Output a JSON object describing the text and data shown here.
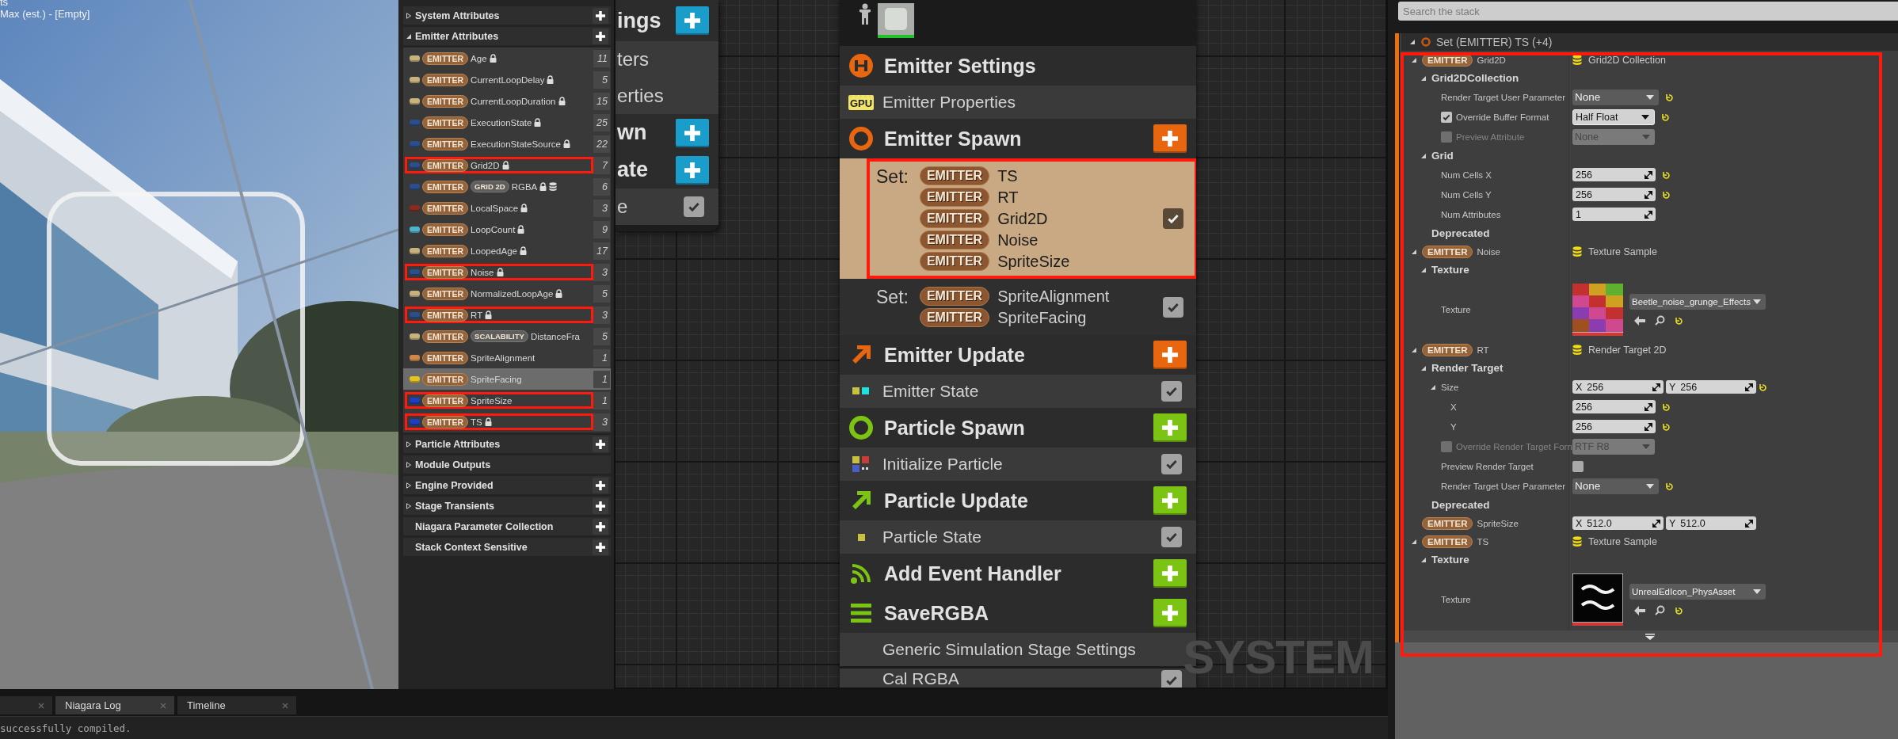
{
  "viewport": {
    "lines": [
      "ts",
      "Max (est.) - [Empty]"
    ]
  },
  "parameters": {
    "sections": [
      {
        "kind": "group",
        "label": "System Attributes",
        "expanded": false,
        "add": true
      },
      {
        "kind": "group",
        "label": "Emitter Attributes",
        "expanded": true,
        "add": true,
        "items": [
          {
            "scope": "EMITTER",
            "name": "Age",
            "color": "#c9b27c",
            "locked": true,
            "stored": false,
            "count": "11",
            "selected": false,
            "highlighted": false
          },
          {
            "scope": "EMITTER",
            "name": "CurrentLoopDelay",
            "color": "#c9b27c",
            "locked": true,
            "stored": false,
            "count": "5",
            "selected": false,
            "highlighted": false
          },
          {
            "scope": "EMITTER",
            "name": "CurrentLoopDuration",
            "color": "#c9b27c",
            "locked": true,
            "stored": false,
            "count": "15",
            "selected": false,
            "highlighted": false
          },
          {
            "scope": "EMITTER",
            "name": "ExecutionState",
            "color": "#2b4f8c",
            "locked": true,
            "stored": false,
            "count": "25",
            "selected": false,
            "highlighted": false
          },
          {
            "scope": "EMITTER",
            "name": "ExecutionStateSource",
            "color": "#2b4f8c",
            "locked": true,
            "stored": false,
            "count": "22",
            "selected": false,
            "highlighted": false
          },
          {
            "scope": "EMITTER",
            "name": "Grid2D",
            "color": "#2b4f8c",
            "locked": true,
            "stored": false,
            "count": "7",
            "selected": false,
            "highlighted": true
          },
          {
            "scope": "EMITTER",
            "tag": "GRID 2D",
            "name": "RGBA",
            "color": "#2b4f8c",
            "locked": true,
            "stored": true,
            "count": "6",
            "selected": false,
            "highlighted": false
          },
          {
            "scope": "EMITTER",
            "name": "LocalSpace",
            "color": "#8a2b20",
            "locked": true,
            "stored": false,
            "count": "3",
            "selected": false,
            "highlighted": false
          },
          {
            "scope": "EMITTER",
            "name": "LoopCount",
            "color": "#4fb3cc",
            "locked": true,
            "stored": false,
            "count": "9",
            "selected": false,
            "highlighted": false
          },
          {
            "scope": "EMITTER",
            "name": "LoopedAge",
            "color": "#c9b27c",
            "locked": true,
            "stored": false,
            "count": "17",
            "selected": false,
            "highlighted": false
          },
          {
            "scope": "EMITTER",
            "name": "Noise",
            "color": "#2b4f8c",
            "locked": true,
            "stored": false,
            "count": "3",
            "selected": false,
            "highlighted": true
          },
          {
            "scope": "EMITTER",
            "name": "NormalizedLoopAge",
            "color": "#c9b27c",
            "locked": true,
            "stored": false,
            "count": "5",
            "selected": false,
            "highlighted": false
          },
          {
            "scope": "EMITTER",
            "name": "RT",
            "color": "#2b4f8c",
            "locked": true,
            "stored": false,
            "count": "3",
            "selected": false,
            "highlighted": true
          },
          {
            "scope": "EMITTER",
            "tag": "SCALABILITY",
            "name": "DistanceFra",
            "color": "#c9b27c",
            "locked": false,
            "stored": false,
            "count": "5",
            "selected": false,
            "highlighted": false
          },
          {
            "scope": "EMITTER",
            "name": "SpriteAlignment",
            "color": "#d0884a",
            "locked": false,
            "stored": false,
            "count": "1",
            "selected": false,
            "highlighted": false
          },
          {
            "scope": "EMITTER",
            "name": "SpriteFacing",
            "color": "#e6c21c",
            "locked": false,
            "stored": false,
            "count": "1",
            "selected": true,
            "highlighted": false
          },
          {
            "scope": "EMITTER",
            "name": "SpriteSize",
            "color": "#1c3fc4",
            "locked": false,
            "stored": false,
            "count": "1",
            "selected": false,
            "highlighted": true
          },
          {
            "scope": "EMITTER",
            "name": "TS",
            "color": "#1c3fc4",
            "locked": true,
            "stored": false,
            "count": "3",
            "selected": false,
            "highlighted": true
          }
        ]
      },
      {
        "kind": "group",
        "label": "Particle Attributes",
        "expanded": false,
        "add": true
      },
      {
        "kind": "group",
        "label": "Module Outputs",
        "expanded": false,
        "add": false
      },
      {
        "kind": "group",
        "label": "Engine Provided",
        "expanded": false,
        "add": true
      },
      {
        "kind": "group",
        "label": "Stage Transients",
        "expanded": false,
        "add": true
      },
      {
        "kind": "plain",
        "label": "Niagara Parameter Collection",
        "add": true
      },
      {
        "kind": "plain",
        "label": "Stack Context Sensitive",
        "add": true
      }
    ]
  },
  "graph": {
    "label": "SYSTEM",
    "system_node": {
      "rows": [
        {
          "kind": "stage",
          "label": "ings",
          "color": "#1b9dcc"
        },
        {
          "kind": "module",
          "label": "ters"
        },
        {
          "kind": "module",
          "label": "erties"
        },
        {
          "kind": "stage",
          "label": "wn",
          "color": "#1b9dcc"
        },
        {
          "kind": "stage",
          "label": "ate",
          "color": "#1b9dcc"
        },
        {
          "kind": "module",
          "label": "e",
          "enabled": true
        }
      ]
    },
    "emitter_node": {
      "rows": [
        {
          "kind": "stage",
          "label": "Emitter Settings",
          "color": "#e8660f",
          "add": false
        },
        {
          "kind": "module",
          "label": "Emitter Properties",
          "badge": "GPU"
        },
        {
          "kind": "stage",
          "label": "Emitter Spawn",
          "color": "#e8660f",
          "add": true
        },
        {
          "kind": "set",
          "label": "Set:",
          "selected": true,
          "highlighted": true,
          "enabled": true,
          "params": [
            {
              "scope": "EMITTER",
              "name": "TS"
            },
            {
              "scope": "EMITTER",
              "name": "RT"
            },
            {
              "scope": "EMITTER",
              "name": "Grid2D"
            },
            {
              "scope": "EMITTER",
              "name": "Noise"
            },
            {
              "scope": "EMITTER",
              "name": "SpriteSize"
            }
          ]
        },
        {
          "kind": "set",
          "label": "Set:",
          "selected": false,
          "highlighted": false,
          "enabled": true,
          "params": [
            {
              "scope": "EMITTER",
              "name": "SpriteAlignment"
            },
            {
              "scope": "EMITTER",
              "name": "SpriteFacing"
            }
          ]
        },
        {
          "kind": "stage",
          "label": "Emitter Update",
          "color": "#e8660f",
          "add": true
        },
        {
          "kind": "module",
          "label": "Emitter State",
          "enabled": true
        },
        {
          "kind": "stage",
          "label": "Particle Spawn",
          "color": "#7cc414",
          "add": true
        },
        {
          "kind": "module",
          "label": "Initialize Particle",
          "enabled": true
        },
        {
          "kind": "stage",
          "label": "Particle Update",
          "color": "#7cc414",
          "add": true
        },
        {
          "kind": "module",
          "label": "Particle State",
          "enabled": true
        },
        {
          "kind": "stage",
          "label": "Add Event Handler",
          "color": "#7cc414",
          "add": true
        },
        {
          "kind": "stage",
          "label": "SaveRGBA",
          "color": "#7cc414",
          "add": true
        },
        {
          "kind": "module",
          "label": "Generic Simulation Stage Settings"
        },
        {
          "kind": "module",
          "label": "Cal RGBA",
          "enabled": true
        }
      ]
    }
  },
  "stack": {
    "search": {
      "placeholder": "Search the stack"
    },
    "header": {
      "title": "Set (EMITTER) TS (+4)",
      "expanded": true
    },
    "highlighted": true,
    "entries": [
      {
        "kind": "param",
        "scope": "EMITTER",
        "name": "Grid2D",
        "expanded": true,
        "value": {
          "kind": "object",
          "text": "Grid2D Collection"
        },
        "children": [
          {
            "kind": "category",
            "label": "Grid2DCollection",
            "expanded": true,
            "children": [
              {
                "kind": "property",
                "label": "Render Target User Parameter",
                "reset": true,
                "value": {
                  "kind": "combo",
                  "text": "None",
                  "disabled": false
                }
              },
              {
                "kind": "property",
                "label": "Override Buffer Format",
                "checkbox": {
                  "checked": true,
                  "disabled": false
                },
                "reset": true,
                "value": {
                  "kind": "dropdown",
                  "text": "Half Float",
                  "disabled": false
                }
              },
              {
                "kind": "property",
                "label": "Preview Attribute",
                "checkbox": {
                  "checked": false,
                  "disabled": true
                },
                "reset": false,
                "value": {
                  "kind": "dropdown",
                  "text": "None",
                  "disabled": true
                }
              }
            ]
          },
          {
            "kind": "category",
            "label": "Grid",
            "expanded": true,
            "children": [
              {
                "kind": "property",
                "label": "Num Cells X",
                "reset": true,
                "value": {
                  "kind": "number",
                  "text": "256"
                }
              },
              {
                "kind": "property",
                "label": "Num Cells Y",
                "reset": true,
                "value": {
                  "kind": "number",
                  "text": "256"
                }
              },
              {
                "kind": "property",
                "label": "Num Attributes",
                "reset": false,
                "value": {
                  "kind": "number",
                  "text": "1"
                }
              }
            ]
          },
          {
            "kind": "category",
            "label": "Deprecated"
          }
        ]
      },
      {
        "kind": "param",
        "scope": "EMITTER",
        "name": "Noise",
        "expanded": true,
        "value": {
          "kind": "object",
          "text": "Texture Sample"
        },
        "children": [
          {
            "kind": "category",
            "label": "Texture",
            "expanded": true,
            "children": [
              {
                "kind": "property",
                "label": "Texture",
                "reset": true,
                "value": {
                  "kind": "texture",
                  "asset": "Beetle_noise_grunge_Effects",
                  "thumbnail": {
                    "kind": "noise"
                  }
                }
              }
            ]
          }
        ]
      },
      {
        "kind": "param",
        "scope": "EMITTER",
        "name": "RT",
        "expanded": true,
        "value": {
          "kind": "object",
          "text": "Render Target 2D"
        },
        "children": [
          {
            "kind": "category",
            "label": "Render Target",
            "expanded": true,
            "children": [
              {
                "kind": "property",
                "label": "Size",
                "expanded": true,
                "reset": true,
                "value": {
                  "kind": "vector",
                  "fields": [
                    {
                      "axis": "X",
                      "text": "256"
                    },
                    {
                      "axis": "Y",
                      "text": "256"
                    }
                  ]
                },
                "children": [
                  {
                    "kind": "property",
                    "label": "X",
                    "reset": true,
                    "value": {
                      "kind": "number",
                      "text": "256"
                    }
                  },
                  {
                    "kind": "property",
                    "label": "Y",
                    "reset": true,
                    "value": {
                      "kind": "number",
                      "text": "256"
                    }
                  }
                ]
              },
              {
                "kind": "property",
                "label": "Override Render Target Forn",
                "checkbox": {
                  "checked": false,
                  "disabled": true
                },
                "reset": false,
                "value": {
                  "kind": "dropdown",
                  "text": "RTF R8",
                  "disabled": true
                }
              },
              {
                "kind": "property",
                "label": "Preview Render Target",
                "reset": false,
                "value": {
                  "kind": "checkbox",
                  "checked": false
                }
              },
              {
                "kind": "property",
                "label": "Render Target User Parameter",
                "reset": true,
                "value": {
                  "kind": "combo",
                  "text": "None",
                  "disabled": false
                }
              }
            ]
          },
          {
            "kind": "category",
            "label": "Deprecated"
          }
        ]
      },
      {
        "kind": "param",
        "scope": "EMITTER",
        "name": "SpriteSize",
        "value": {
          "kind": "vector",
          "fields": [
            {
              "axis": "X",
              "text": "512.0"
            },
            {
              "axis": "Y",
              "text": "512.0"
            }
          ]
        }
      },
      {
        "kind": "param",
        "scope": "EMITTER",
        "name": "TS",
        "expanded": true,
        "value": {
          "kind": "object",
          "text": "Texture Sample"
        },
        "children": [
          {
            "kind": "category",
            "label": "Texture",
            "expanded": true,
            "children": [
              {
                "kind": "property",
                "label": "Texture",
                "reset": true,
                "value": {
                  "kind": "texture",
                  "asset": "UnrealEdIcon_PhysAsset",
                  "thumbnail": {
                    "kind": "dark"
                  }
                }
              }
            ]
          }
        ]
      }
    ]
  },
  "bottom": {
    "tabs": [
      {
        "selected": false
      },
      {
        "label": "Niagara Log",
        "selected": true
      },
      {
        "label": "Timeline",
        "selected": false
      }
    ],
    "log": "successfully compiled."
  }
}
